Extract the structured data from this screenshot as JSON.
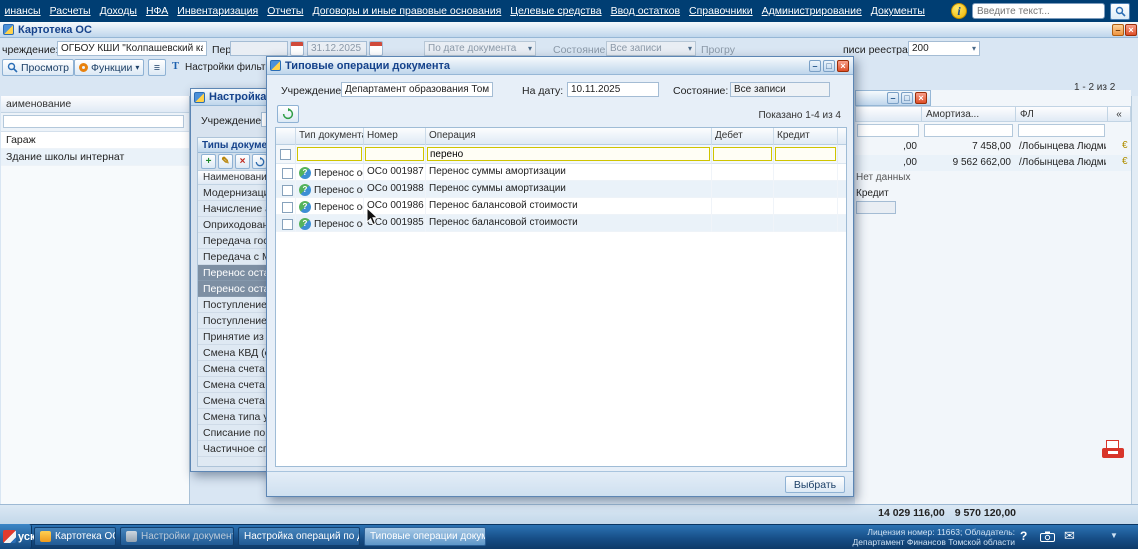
{
  "colors": {
    "accent": "#15428b",
    "menu_bg": "#003e73",
    "filter_border": "#cfc400",
    "selected_row": "#7d8fa3",
    "close_red": "#de4f28"
  },
  "icons": {
    "chevron_down": "▾",
    "minimize": "–",
    "maximize": "□",
    "close": "×",
    "menu_list": "≡",
    "collapse_left": "«",
    "info": "i",
    "filter": "Т",
    "add": "+",
    "edit": "✎",
    "delete": "×",
    "envelope": "✉",
    "dropdown": "▼",
    "currency": "€",
    "help": "?"
  },
  "top_menu": {
    "items": [
      "инансы",
      "Расчеты",
      "Доходы",
      "НФА",
      "Инвентаризация",
      "Отчеты",
      "Договоры и иные правовые основания",
      "Целевые средства",
      "Ввод остатков",
      "Справочники",
      "Администрирование",
      "Документы"
    ],
    "search": {
      "placeholder": "Введите текст..."
    }
  },
  "main_window": {
    "title": "Картотека ОС",
    "form": {
      "institution_label": "чреждение:",
      "institution_value": "ОГБОУ КШИ \"Колпашевский каде",
      "period_label": "Пери",
      "date_to": "31.12.2025",
      "doc_date_combo": "По дате документа",
      "state_label": "Состояние:",
      "state_combo": "Все записи",
      "loaded_fragment": "Прогру",
      "registry_label": "писи реестра:",
      "registry_combo": "200"
    },
    "toolbar": {
      "view": "Просмотр",
      "functions": "Функции",
      "filter_status": "Настройки фильтрации: ВКЛ"
    },
    "pager": "1 - 2 из 2",
    "left_grid": {
      "header": "аименование",
      "rows": [
        "Гараж",
        "Здание школы интернат"
      ]
    },
    "right_grid": {
      "col_amort": "Амортиза...",
      "col_fl": "ФЛ",
      "rows": [
        {
          "cut": ",00",
          "amort": "7 458,00",
          "fl": "/Лобынцева Людми..."
        },
        {
          "cut": ",00",
          "amort": "9 562 662,00",
          "fl": "/Лобынцева Людми..."
        }
      ],
      "no_data": "Нет данных",
      "credit_label": "Кредит"
    },
    "totals": {
      "balance": "14 029 116,00",
      "amort": "9 570 120,00"
    }
  },
  "settings_dialog": {
    "title": "Настройка опер",
    "institution_label": "Учреждение:",
    "panel_title": "Типы докумен",
    "grid_header": "Наименование",
    "items": [
      "Модернизация",
      "Начисление ам...",
      "Оприходовани...",
      "Передача госу...",
      "Передача с МО...",
      "Перенос остат...",
      "Перенос остат...",
      "Поступление О...",
      "Поступление п...",
      "Принятие из к...",
      "Смена КВД (с ...",
      "Смена счета О...",
      "Смена счета О...",
      "Смена счета с...",
      "Смена типа уч...",
      "Списание по п...",
      "Частичное спи..."
    ]
  },
  "modal": {
    "title": "Типовые операции документа",
    "institution_label": "Учреждение:",
    "institution_value": "Департамент образования Томск",
    "date_label": "На дату:",
    "date_value": "10.11.2025",
    "state_label": "Состояние:",
    "state_value": "Все записи",
    "shown": "Показано 1-4 из 4",
    "columns": {
      "type": "Тип документа",
      "num": "Номер",
      "op": "Операция",
      "debit": "Дебет",
      "credit": "Кредит"
    },
    "filters": {
      "op": "перено"
    },
    "rows": [
      {
        "type": "Перенос ос...",
        "num": "ОСо 001987",
        "op": "Перенос суммы амортизации"
      },
      {
        "type": "Перенос ос...",
        "num": "ОСо 001988",
        "op": "Перенос суммы амортизации"
      },
      {
        "type": "Перенос ос...",
        "num": "ОСо 001986",
        "op": "Перенос балансовой стоимости"
      },
      {
        "type": "Перенос ос...",
        "num": "ОСо 001985",
        "op": "Перенос балансовой стоимости"
      }
    ],
    "select_button": "Выбрать"
  },
  "taskbar": {
    "start": "уск",
    "items": [
      "Картотека ОС",
      "Настройки документов (...",
      "Настройка операций по доку...",
      "Типовые операции докум..."
    ],
    "license_line1": "Лицензия номер: 11663; Обладатель:",
    "license_line2": "Департамент Финансов Томской области"
  }
}
